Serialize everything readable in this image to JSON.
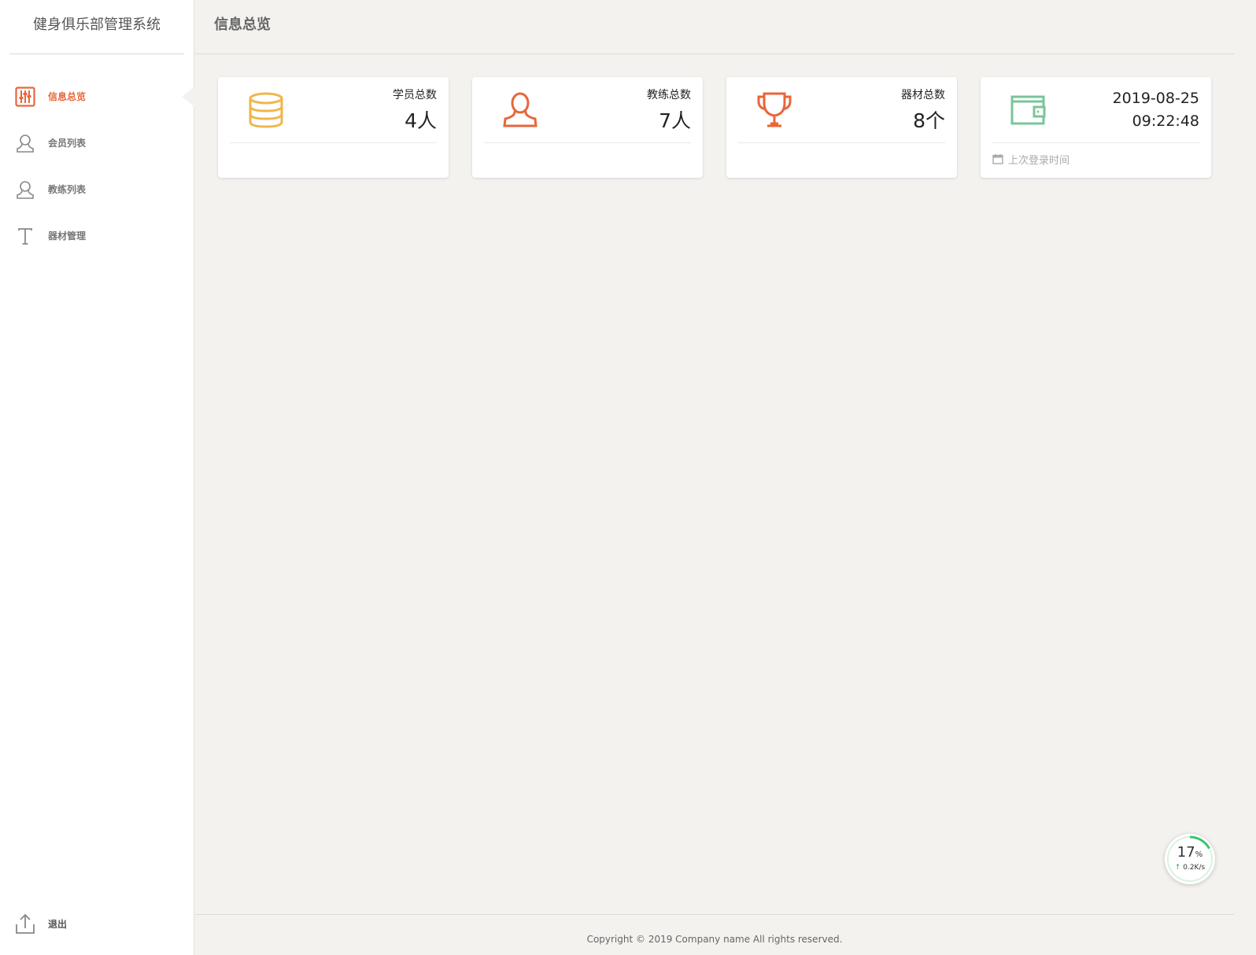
{
  "app": {
    "title": "健身俱乐部管理系统"
  },
  "sidebar": {
    "items": [
      {
        "label": "信息总览",
        "icon": "sliders-icon",
        "active": true
      },
      {
        "label": "会员列表",
        "icon": "user-icon",
        "active": false
      },
      {
        "label": "教练列表",
        "icon": "user-icon",
        "active": false
      },
      {
        "label": "器材管理",
        "icon": "text-t-icon",
        "active": false
      }
    ],
    "logout": {
      "label": "退出",
      "icon": "upload-icon"
    }
  },
  "header": {
    "title": "信息总览"
  },
  "cards": [
    {
      "label": "学员总数",
      "value": "4人",
      "icon": "database-icon",
      "color": "#f0b64a"
    },
    {
      "label": "教练总数",
      "value": "7人",
      "icon": "user-icon",
      "color": "#e8663a"
    },
    {
      "label": "器材总数",
      "value": "8个",
      "icon": "trophy-icon",
      "color": "#e8663a"
    },
    {
      "date": "2019-08-25",
      "time": "09:22:48",
      "footer": "上次登录时间",
      "icon": "wallet-icon",
      "footer_icon": "calendar-icon",
      "color": "#7ac49a"
    }
  ],
  "footer": {
    "text": "Copyright © 2019 Company name All rights reserved."
  },
  "speed_widget": {
    "percent": "17",
    "unit": "%",
    "rate": "0.2K/s",
    "progress": 0.17
  },
  "colors": {
    "accent": "#e8663a",
    "gold": "#f0b64a",
    "green": "#7ac49a"
  }
}
